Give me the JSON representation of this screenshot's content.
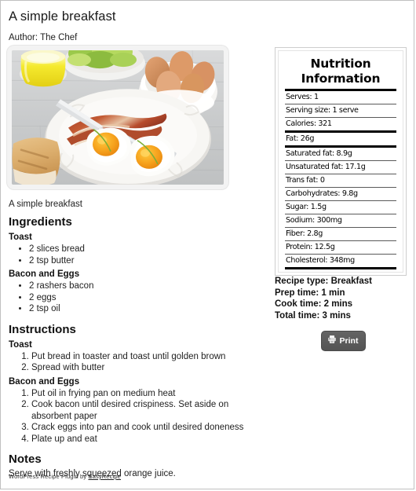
{
  "recipe": {
    "title": "A simple breakfast",
    "author_line": "Author: The Chef",
    "photo_caption": "A simple breakfast",
    "photo_alt": "breakfast-photo"
  },
  "ingredients": {
    "heading": "Ingredients",
    "groups": [
      {
        "name": "Toast",
        "items": [
          "2 slices bread",
          "2 tsp butter"
        ]
      },
      {
        "name": "Bacon and Eggs",
        "items": [
          "2 rashers bacon",
          "2 eggs",
          "2 tsp oil"
        ]
      }
    ]
  },
  "instructions": {
    "heading": "Instructions",
    "groups": [
      {
        "name": "Toast",
        "steps": [
          "Put bread in toaster and toast until golden brown",
          "Spread with butter"
        ]
      },
      {
        "name": "Bacon and Eggs",
        "steps": [
          "Put oil in frying pan on medium heat",
          "Cook bacon until desired crispiness. Set aside on absorbent paper",
          "Crack eggs into pan and cook until desired doneness",
          "Plate up and eat"
        ]
      }
    ]
  },
  "notes": {
    "heading": "Notes",
    "text": "Serve with freshly squeezed orange juice."
  },
  "footer": {
    "prefix": "WordPress Recipe Plugin by ",
    "link_label": "EasyRecipe"
  },
  "nutrition": {
    "title_line1": "Nutrition",
    "title_line2": "Information",
    "rows": [
      {
        "label": "Serves: 1",
        "rule_after": "thin"
      },
      {
        "label": "Serving size: 1 serve",
        "rule_after": "thin"
      },
      {
        "label": "Calories: 321",
        "rule_after": "thick"
      },
      {
        "label": "Fat: 26g",
        "rule_after": "thick"
      },
      {
        "label": "Saturated fat: 8.9g",
        "rule_after": "thin"
      },
      {
        "label": "Unsaturated fat: 17.1g",
        "rule_after": "thin"
      },
      {
        "label": "Trans fat: 0",
        "rule_after": "thin"
      },
      {
        "label": "Carbohydrates: 9.8g",
        "rule_after": "thin"
      },
      {
        "label": "Sugar: 1.5g",
        "rule_after": "thin"
      },
      {
        "label": "Sodium: 300mg",
        "rule_after": "thin"
      },
      {
        "label": "Fiber: 2.8g",
        "rule_after": "thin"
      },
      {
        "label": "Protein: 12.5g",
        "rule_after": "thin"
      },
      {
        "label": "Cholesterol: 348mg",
        "rule_after": "thick"
      }
    ]
  },
  "meta": {
    "rows": [
      "Recipe type: Breakfast",
      "Prep time:  1 min",
      "Cook time:  2 mins",
      "Total time:  3 mins"
    ]
  },
  "print_button": {
    "label": "Print",
    "icon": "printer-icon"
  },
  "colors": {
    "card_border": "#c0c0c0",
    "photo_frame": "#f3f3f3",
    "print_button_bg": "#5c5c5c",
    "text": "#222222",
    "rule": "#000000"
  }
}
